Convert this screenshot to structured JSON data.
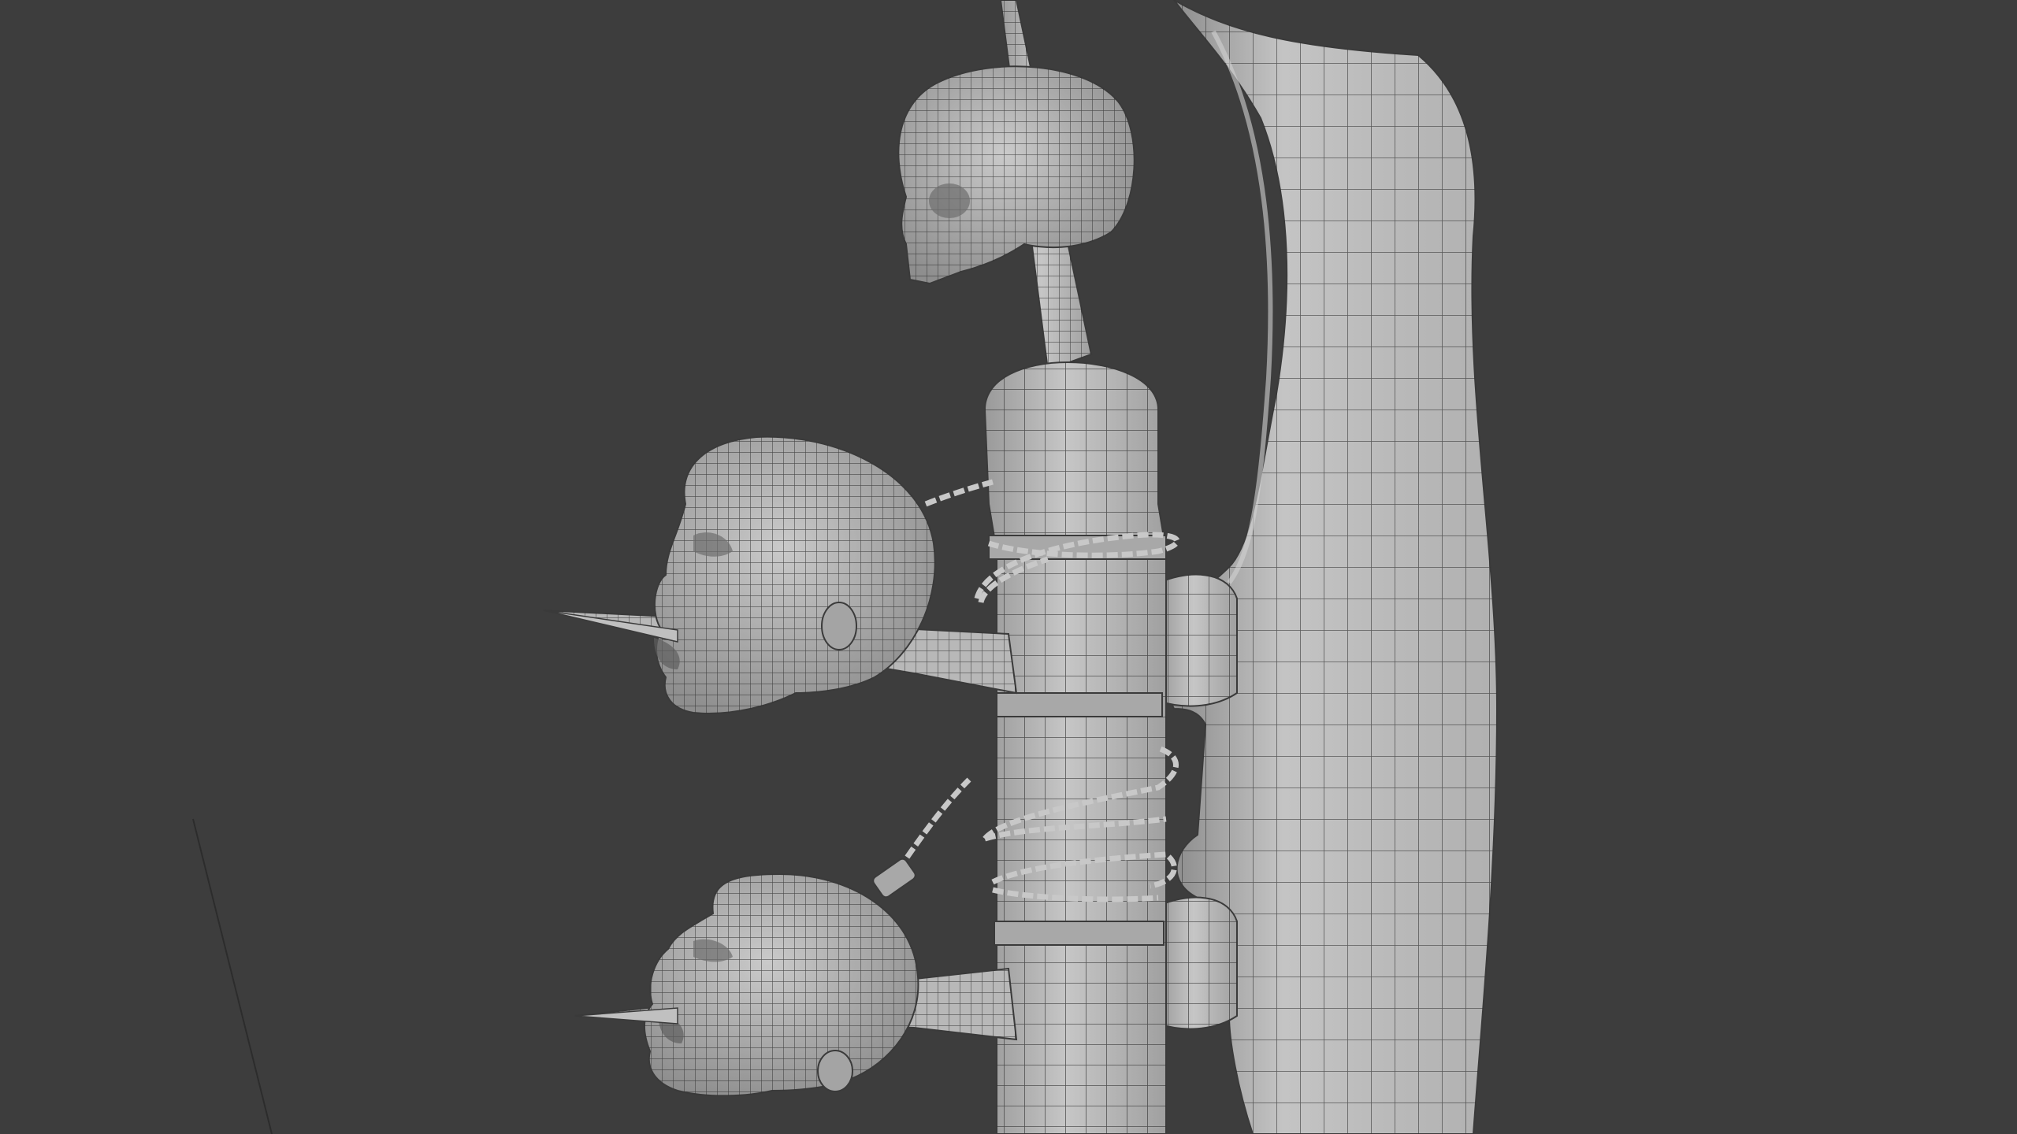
{
  "viewport": {
    "background": "#3d3d3d",
    "mesh_fill": "#b4b4b4",
    "mesh_shade": "#8f8f8f",
    "wire": "#2e2e2e",
    "chain": "#c8c8c8"
  },
  "objects": [
    "blade-arm",
    "pole",
    "top-spike",
    "skull",
    "upper-head",
    "lower-head",
    "upper-spike",
    "lower-spike",
    "chain-loops"
  ]
}
